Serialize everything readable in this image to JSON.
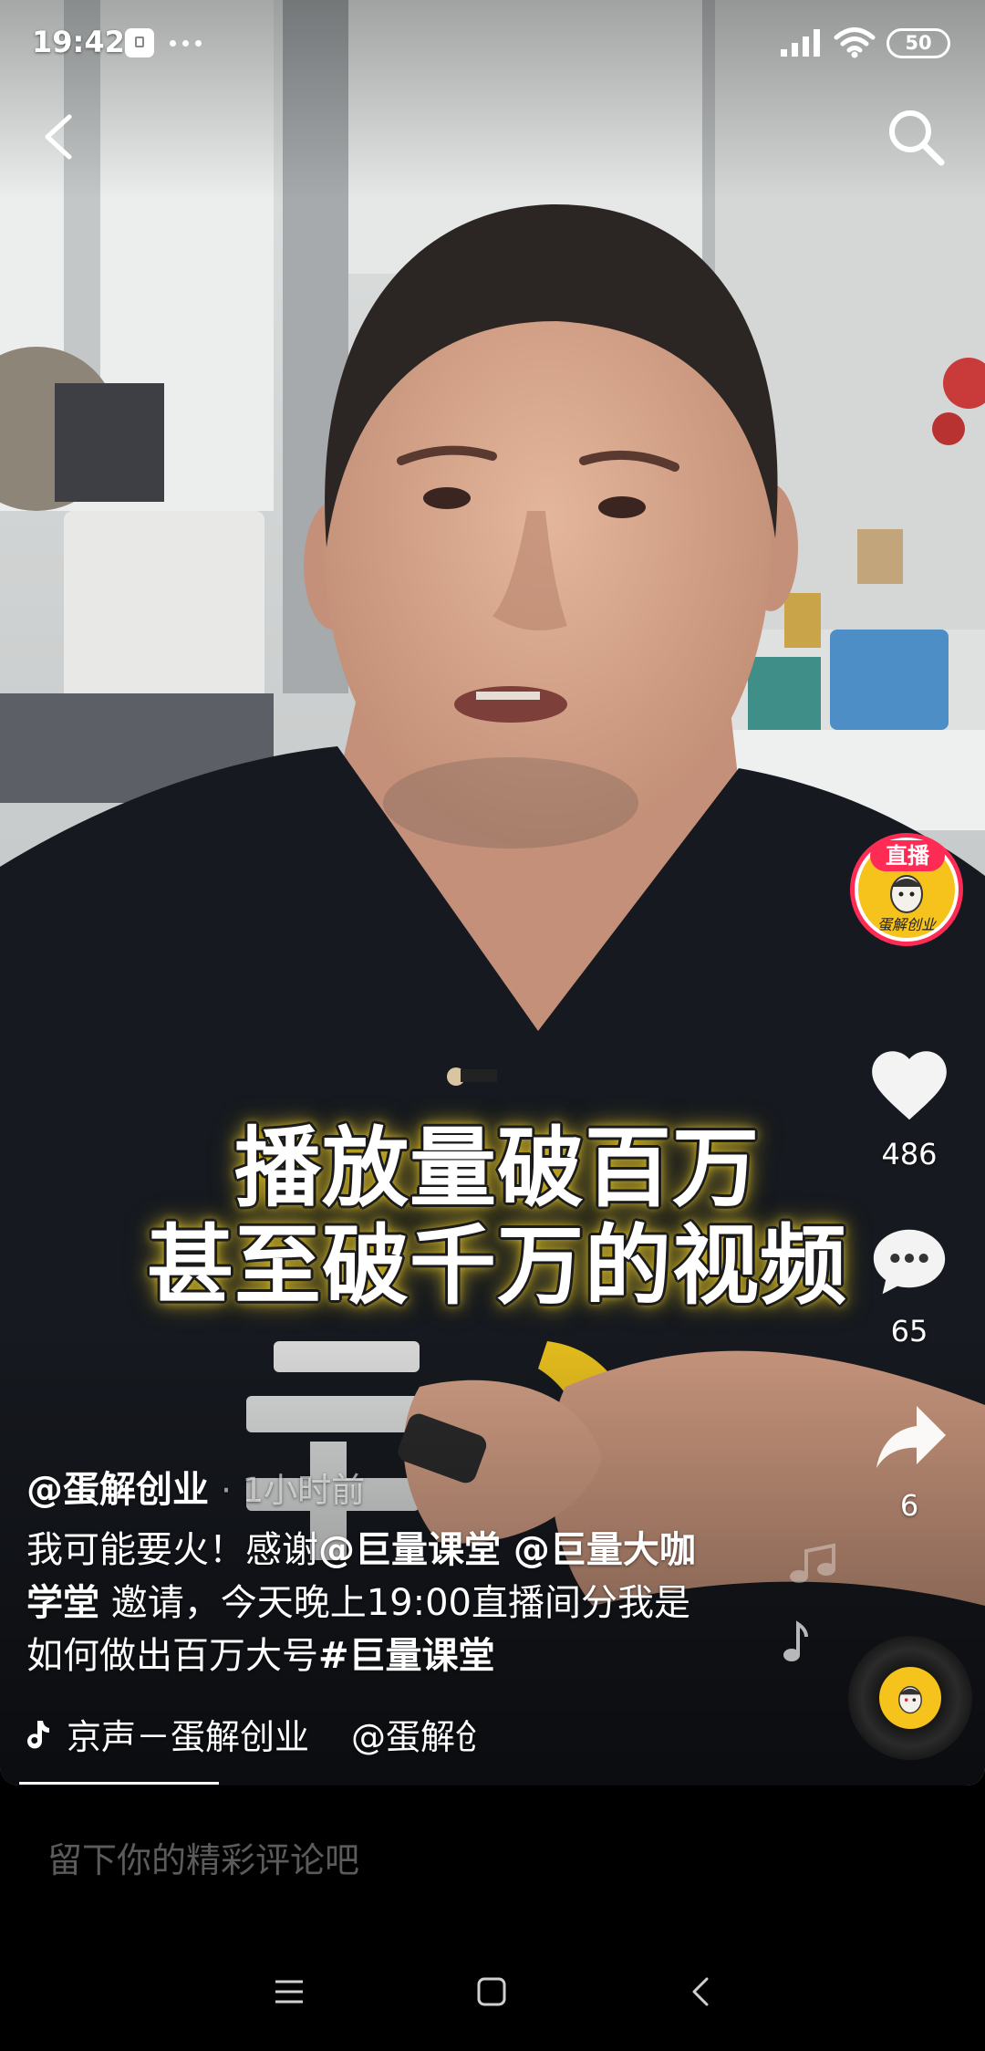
{
  "status_bar": {
    "time": "19:42",
    "battery": "50",
    "icons": [
      "notification-icon",
      "more-dots-icon",
      "signal-icon",
      "wifi-icon",
      "battery-icon"
    ]
  },
  "top_bar": {
    "icons": [
      "back-icon",
      "search-icon"
    ]
  },
  "video": {
    "caption": [
      "播放量破百万",
      "甚至破千万的视频"
    ]
  },
  "author": {
    "name": "@蛋解创业",
    "time": "· 1小时前",
    "live_badge": "直播",
    "avatar_logo_text": "蛋解创业"
  },
  "description": {
    "lines": [
      [
        {
          "text": "我可能要火！感谢",
          "bold": false
        },
        {
          "text": "@巨量课堂 @巨量大咖",
          "bold": true
        }
      ],
      [
        {
          "text": "学堂",
          "bold": true
        },
        {
          "text": " 邀请，今天晚上19:00直播间分我是",
          "bold": false
        }
      ],
      [
        {
          "text": "如何做出百万大号",
          "bold": false
        },
        {
          "text": "#巨量课堂",
          "bold": true
        }
      ]
    ]
  },
  "music": {
    "title": "京声－蛋解创业",
    "author": "@蛋解创"
  },
  "actions": {
    "likes": "486",
    "comments": "65",
    "shares": "6"
  },
  "comment_box": {
    "placeholder": "留下你的精彩评论吧"
  },
  "colors": {
    "live_pink": "#fe2c55",
    "avatar_yellow": "#f6c21c",
    "background": "#000000"
  },
  "nav_bar": {
    "icons": [
      "menu-icon",
      "home-square-icon",
      "back-nav-icon"
    ]
  }
}
